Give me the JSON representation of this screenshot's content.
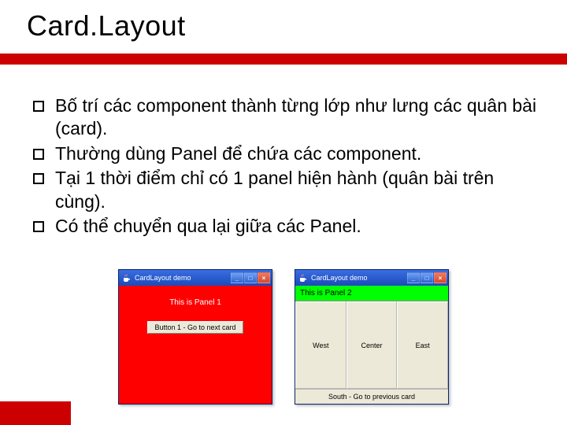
{
  "slide": {
    "title": "Card.Layout",
    "bullets": [
      "Bố trí các component thành từng lớp như lưng các quân bài (card).",
      "Thường dùng Panel để chứa các component.",
      "Tại 1 thời điểm chỉ có 1 panel hiện hành (quân bài trên cùng).",
      "Có thể chuyển qua lại giữa các Panel."
    ]
  },
  "windows": {
    "left": {
      "title": "CardLayout demo",
      "panel_label": "This is Panel 1",
      "button_label": "Button 1 - Go to next card"
    },
    "right": {
      "title": "CardLayout demo",
      "north_label": "This is Panel 2",
      "west_label": "West",
      "center_label": "Center",
      "east_label": "East",
      "south_label": "South - Go to previous card"
    }
  },
  "window_controls": {
    "min_glyph": "_",
    "max_glyph": "□",
    "close_glyph": "×"
  }
}
